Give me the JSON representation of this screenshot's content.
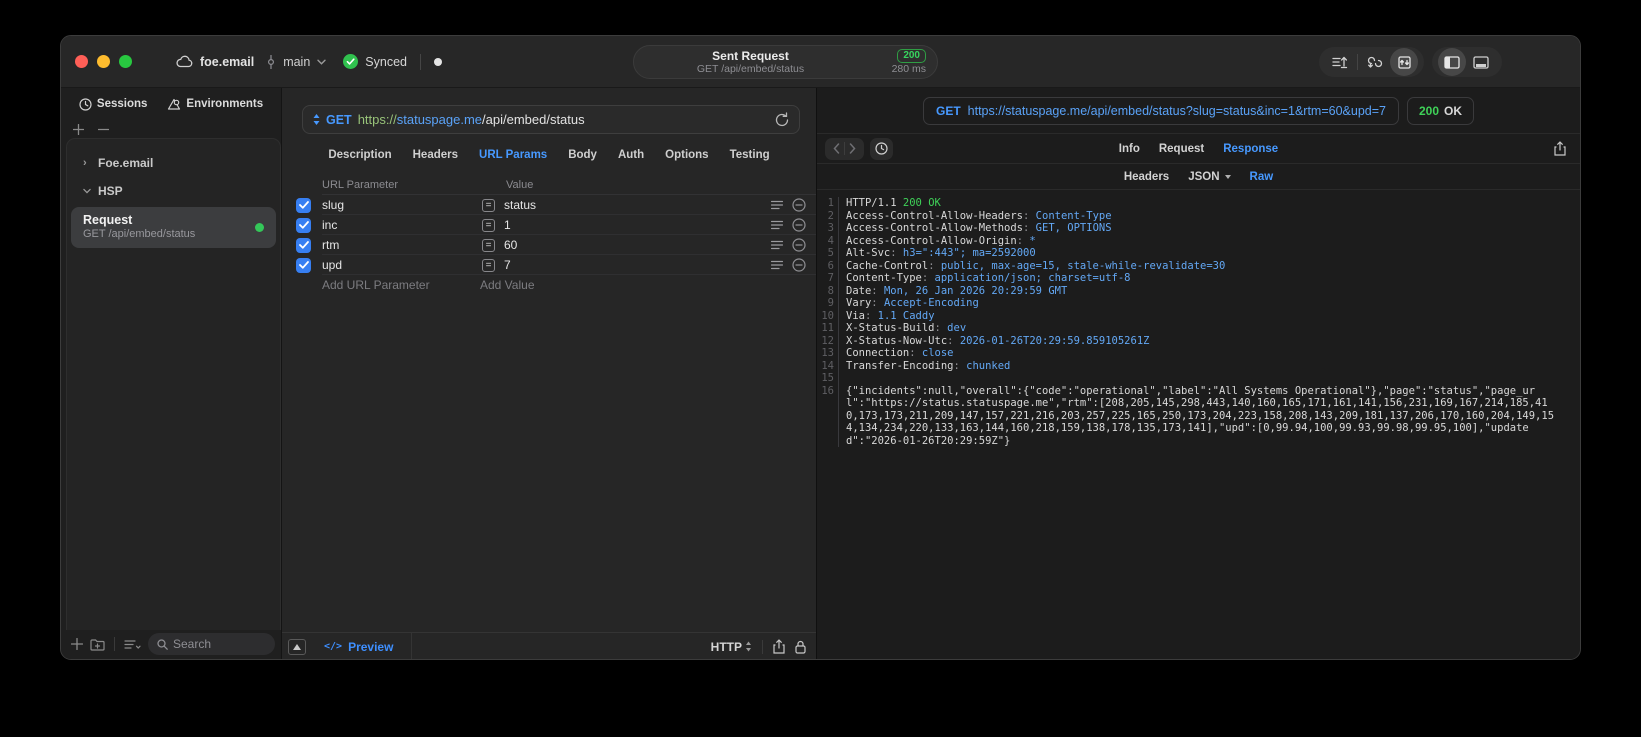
{
  "titlebar": {
    "workspace": "foe.email",
    "branch": "main",
    "sync_label": "Synced",
    "request_summary": {
      "title": "Sent Request",
      "subtitle": "GET /api/embed/status",
      "status_code": "200",
      "duration": "280 ms"
    }
  },
  "sidebar": {
    "tabs": [
      {
        "label": "Sessions"
      },
      {
        "label": "Environments"
      }
    ],
    "groups": [
      {
        "label": "Foe.email"
      },
      {
        "label": "HSP"
      }
    ],
    "request_item": {
      "title": "Request",
      "subtitle": "GET /api/embed/status"
    },
    "search": {
      "placeholder": "Search"
    }
  },
  "editor": {
    "method": "GET",
    "url": {
      "scheme": "https://",
      "host": "statuspage.me",
      "path": "/api/embed/status"
    },
    "tabs": [
      "Description",
      "Headers",
      "URL Params",
      "Body",
      "Auth",
      "Options",
      "Testing"
    ],
    "active_tab": "URL Params",
    "params": {
      "name_header": "URL Parameter",
      "value_header": "Value",
      "rows": [
        {
          "name": "slug",
          "value": "status",
          "checked": true
        },
        {
          "name": "inc",
          "value": "1",
          "checked": true
        },
        {
          "name": "rtm",
          "value": "60",
          "checked": true
        },
        {
          "name": "upd",
          "value": "7",
          "checked": true
        }
      ],
      "add_name": "Add URL Parameter",
      "add_value": "Add Value"
    },
    "footer": {
      "code_glyph": "</>",
      "preview": "Preview",
      "protocol": "HTTP"
    }
  },
  "response": {
    "request_line": {
      "method": "GET",
      "url": "https://statuspage.me/api/embed/status?slug=status&inc=1&rtm=60&upd=7"
    },
    "status": {
      "code": "200",
      "text": "OK"
    },
    "tabs": [
      "Info",
      "Request",
      "Response"
    ],
    "active_tab": "Response",
    "subtabs": [
      "Headers",
      "JSON",
      "Raw"
    ],
    "active_subtab": "Raw",
    "body": {
      "lines": [
        {
          "n": "1",
          "segments": [
            {
              "c": "plain",
              "t": "HTTP/1.1 "
            },
            {
              "c": "green",
              "t": "200 OK"
            }
          ]
        },
        {
          "n": "2",
          "segments": [
            {
              "c": "plain",
              "t": "Access-Control-Allow-Headers"
            },
            {
              "c": "dim",
              "t": ": "
            },
            {
              "c": "blue",
              "t": "Content-Type"
            }
          ]
        },
        {
          "n": "3",
          "segments": [
            {
              "c": "plain",
              "t": "Access-Control-Allow-Methods"
            },
            {
              "c": "dim",
              "t": ": "
            },
            {
              "c": "blue",
              "t": "GET, OPTIONS"
            }
          ]
        },
        {
          "n": "4",
          "segments": [
            {
              "c": "plain",
              "t": "Access-Control-Allow-Origin"
            },
            {
              "c": "dim",
              "t": ": "
            },
            {
              "c": "blue",
              "t": "*"
            }
          ]
        },
        {
          "n": "5",
          "segments": [
            {
              "c": "plain",
              "t": "Alt-Svc"
            },
            {
              "c": "dim",
              "t": ": "
            },
            {
              "c": "blue",
              "t": "h3=\":443\"; ma=2592000"
            }
          ]
        },
        {
          "n": "6",
          "segments": [
            {
              "c": "plain",
              "t": "Cache-Control"
            },
            {
              "c": "dim",
              "t": ": "
            },
            {
              "c": "blue",
              "t": "public, max-age=15, stale-while-revalidate=30"
            }
          ]
        },
        {
          "n": "7",
          "segments": [
            {
              "c": "plain",
              "t": "Content-Type"
            },
            {
              "c": "dim",
              "t": ": "
            },
            {
              "c": "blue",
              "t": "application/json; charset=utf-8"
            }
          ]
        },
        {
          "n": "8",
          "segments": [
            {
              "c": "plain",
              "t": "Date"
            },
            {
              "c": "dim",
              "t": ": "
            },
            {
              "c": "blue",
              "t": "Mon, 26 Jan 2026 20:29:59 GMT"
            }
          ]
        },
        {
          "n": "9",
          "segments": [
            {
              "c": "plain",
              "t": "Vary"
            },
            {
              "c": "dim",
              "t": ": "
            },
            {
              "c": "blue",
              "t": "Accept-Encoding"
            }
          ]
        },
        {
          "n": "10",
          "segments": [
            {
              "c": "plain",
              "t": "Via"
            },
            {
              "c": "dim",
              "t": ": "
            },
            {
              "c": "blue",
              "t": "1.1 Caddy"
            }
          ]
        },
        {
          "n": "11",
          "segments": [
            {
              "c": "plain",
              "t": "X-Status-Build"
            },
            {
              "c": "dim",
              "t": ": "
            },
            {
              "c": "blue",
              "t": "dev"
            }
          ]
        },
        {
          "n": "12",
          "segments": [
            {
              "c": "plain",
              "t": "X-Status-Now-Utc"
            },
            {
              "c": "dim",
              "t": ": "
            },
            {
              "c": "blue",
              "t": "2026-01-26T20:29:59.859105261Z"
            }
          ]
        },
        {
          "n": "13",
          "segments": [
            {
              "c": "plain",
              "t": "Connection"
            },
            {
              "c": "dim",
              "t": ": "
            },
            {
              "c": "blue",
              "t": "close"
            }
          ]
        },
        {
          "n": "14",
          "segments": [
            {
              "c": "plain",
              "t": "Transfer-Encoding"
            },
            {
              "c": "dim",
              "t": ": "
            },
            {
              "c": "blue",
              "t": "chunked"
            }
          ]
        },
        {
          "n": "15",
          "segments": []
        },
        {
          "n": "16",
          "segments": [
            {
              "c": "plain",
              "t": "{\"incidents\":null,\"overall\":{\"code\":\"operational\",\"label\":\"All Systems Operational\"},\"page\":\"status\",\"page_url\":\"https://status.statuspage.me\",\"rtm\":[208,205,145,298,443,140,160,165,171,161,141,156,231,169,167,214,185,410,173,173,211,209,147,157,221,216,203,257,225,165,250,173,204,223,158,208,143,209,181,137,206,170,160,204,149,154,134,234,220,133,163,144,160,218,159,138,178,135,173,141],\"upd\":[0,99.94,100,99.93,99.98,99.95,100],\"updated\":\"2026-01-26T20:29:59Z\"}"
            }
          ]
        }
      ]
    }
  },
  "colors": {
    "accent_blue": "#4799ff",
    "status_green": "#32d74b",
    "checkbox_blue": "#377ff2",
    "url_scheme_green": "#98c379",
    "url_host_blue": "#5aa2f7",
    "header_value_blue": "#63a8f5"
  }
}
